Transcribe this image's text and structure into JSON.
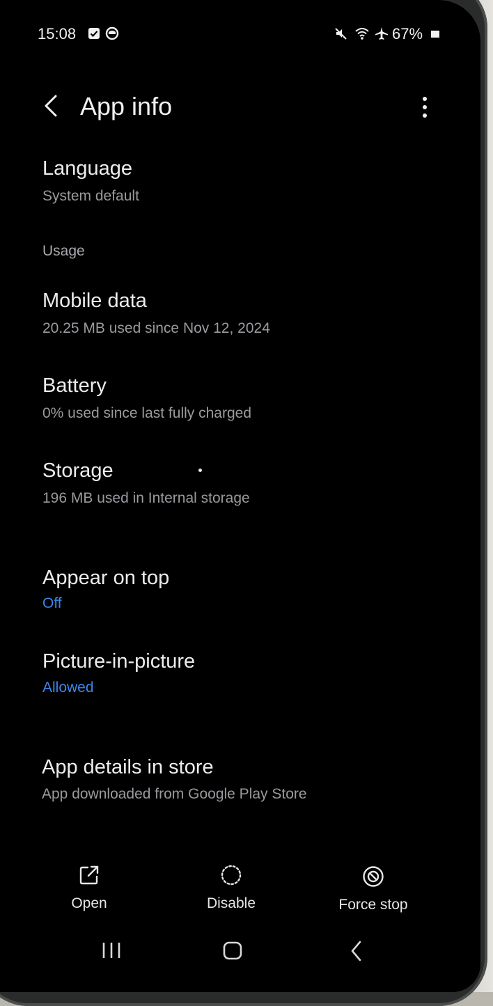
{
  "status_bar": {
    "time": "15:08",
    "battery": "67%",
    "icons": [
      "checkbox-notification-icon",
      "circle-notification-icon",
      "mute-icon",
      "wifi-icon",
      "airplane-icon",
      "battery-icon"
    ]
  },
  "header": {
    "title": "App info",
    "back_icon": "back-chevron-icon",
    "more_icon": "more-vert-icon"
  },
  "items": {
    "language": {
      "title": "Language",
      "subtitle": "System default"
    },
    "usage_header": "Usage",
    "mobile_data": {
      "title": "Mobile data",
      "subtitle": "20.25 MB used since Nov 12, 2024"
    },
    "battery": {
      "title": "Battery",
      "subtitle": "0% used since last fully charged"
    },
    "storage": {
      "title": "Storage",
      "subtitle": "196 MB used in Internal storage"
    },
    "appear_on_top": {
      "title": "Appear on top",
      "subtitle": "Off"
    },
    "pip": {
      "title": "Picture-in-picture",
      "subtitle": "Allowed"
    },
    "store": {
      "title": "App details in store",
      "subtitle": "App downloaded from Google Play Store"
    }
  },
  "actions": {
    "open": "Open",
    "disable": "Disable",
    "force_stop": "Force stop"
  },
  "nav": {
    "recents_icon": "recents-icon",
    "home_icon": "home-icon",
    "back_icon": "back-icon"
  },
  "colors": {
    "background": "#000000",
    "text_primary": "#f1f1f3",
    "text_secondary": "#9a9a9f",
    "accent": "#3e86e8"
  }
}
